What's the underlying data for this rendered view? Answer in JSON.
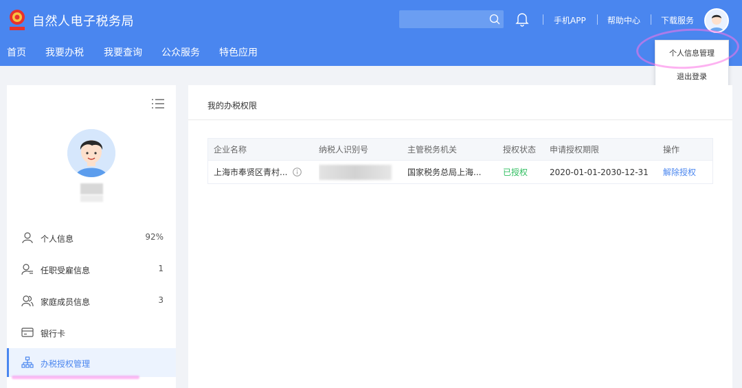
{
  "header": {
    "site_title": "自然人电子税务局",
    "search": {
      "placeholder": ""
    },
    "links": [
      "手机APP",
      "帮助中心",
      "下载服务"
    ],
    "nav": [
      "首页",
      "我要办税",
      "我要查询",
      "公众服务",
      "特色应用"
    ]
  },
  "dropdown": {
    "items": [
      "个人信息管理",
      "退出登录"
    ]
  },
  "sidebar": {
    "items": [
      {
        "label": "个人信息",
        "count": "92%",
        "icon": "person-icon"
      },
      {
        "label": "任职受雇信息",
        "count": "1",
        "icon": "employment-icon"
      },
      {
        "label": "家庭成员信息",
        "count": "3",
        "icon": "family-icon"
      },
      {
        "label": "银行卡",
        "count": "",
        "icon": "bank-card-icon"
      },
      {
        "label": "办税授权管理",
        "count": "",
        "icon": "org-chart-icon"
      }
    ]
  },
  "main": {
    "title": "我的办税权限",
    "table": {
      "columns": [
        "企业名称",
        "纳税人识别号",
        "主管税务机关",
        "授权状态",
        "申请授权期限",
        "操作"
      ],
      "rows": [
        {
          "company": "上海市奉贤区青村...",
          "tax_id": "",
          "authority": "国家税务总局上海...",
          "status": "已授权",
          "period": "2020-01-01-2030-12-31",
          "action": "解除授权"
        }
      ]
    }
  },
  "colors": {
    "brand": "#4a86ef",
    "status_ok": "#2fbe5f",
    "highlight": "#fb72e6"
  }
}
